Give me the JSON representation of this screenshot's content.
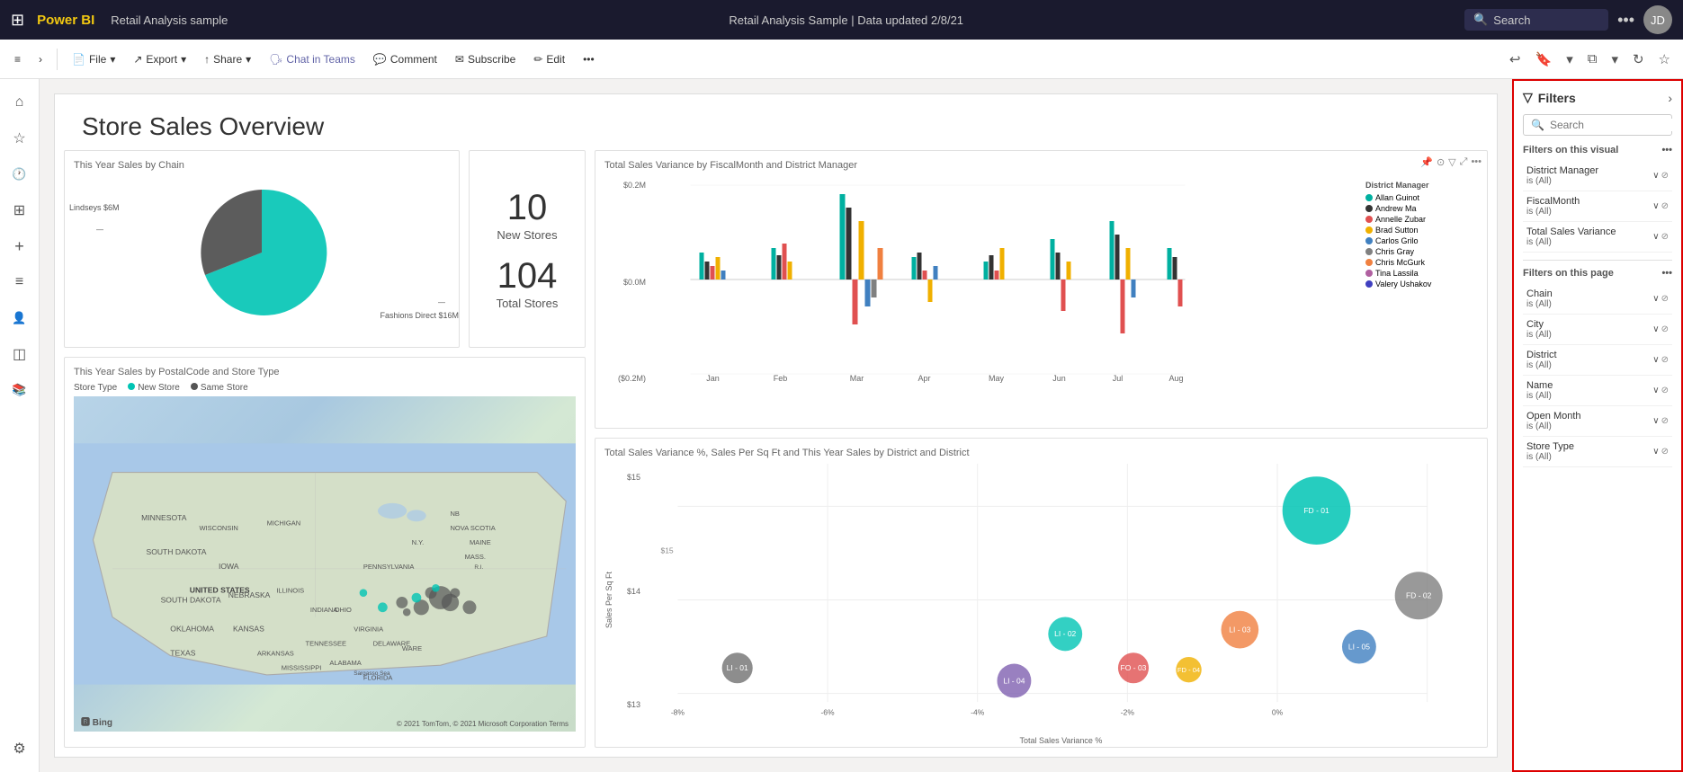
{
  "topnav": {
    "waffle_icon": "⊞",
    "brand": "Power BI",
    "report_name": "Retail Analysis sample",
    "center_title": "Retail Analysis Sample  |  Data updated 2/8/21",
    "dropdown_icon": "▾",
    "search_placeholder": "Search",
    "more_icon": "•••",
    "avatar_initials": "JD"
  },
  "ribbon": {
    "hamburger": "≡",
    "chevron_right": "›",
    "file_label": "File",
    "export_label": "Export",
    "share_label": "Share",
    "chat_label": "Chat in Teams",
    "comment_label": "Comment",
    "subscribe_label": "Subscribe",
    "edit_label": "Edit",
    "more_icon": "•••",
    "undo_icon": "↩",
    "bookmark_icon": "🔖",
    "view_icon": "⧉",
    "refresh_icon": "↻",
    "star_icon": "☆"
  },
  "sidebar": {
    "icons": [
      {
        "name": "home-icon",
        "glyph": "⌂",
        "active": false
      },
      {
        "name": "favorites-icon",
        "glyph": "☆",
        "active": false
      },
      {
        "name": "recent-icon",
        "glyph": "🕐",
        "active": false
      },
      {
        "name": "apps-icon",
        "glyph": "⊞",
        "active": false
      },
      {
        "name": "shared-icon",
        "glyph": "+",
        "active": false
      },
      {
        "name": "dataflow-icon",
        "glyph": "≡",
        "active": false
      },
      {
        "name": "people-icon",
        "glyph": "👤",
        "active": false
      },
      {
        "name": "metrics-icon",
        "glyph": "◫",
        "active": false
      },
      {
        "name": "learn-icon",
        "glyph": "📚",
        "active": false
      },
      {
        "name": "settings-icon",
        "glyph": "⚙",
        "active": false,
        "bottom": true
      }
    ]
  },
  "page": {
    "title": "Store Sales Overview",
    "visuals": {
      "pie_chart": {
        "title": "This Year Sales by Chain",
        "labels": {
          "lindseys": "Lindseys $6M",
          "fashions_direct": "Fashions Direct $16M"
        }
      },
      "kpi": {
        "new_stores_value": "10",
        "new_stores_label": "New Stores",
        "total_stores_value": "104",
        "total_stores_label": "Total Stores"
      },
      "map": {
        "title": "This Year Sales by PostalCode and Store Type",
        "legend_label": "Store Type",
        "new_store_label": "New Store",
        "same_store_label": "Same Store",
        "country_label": "UNITED STATES",
        "bing_label": "🅱 Bing",
        "footer": "© 2021 TomTom, © 2021 Microsoft Corporation  Terms"
      },
      "bar_chart": {
        "title": "Total Sales Variance by FiscalMonth and District Manager",
        "y_labels": [
          "$0.2M",
          "$0.0M",
          "($0.2M)"
        ],
        "x_labels": [
          "Jan",
          "Feb",
          "Mar",
          "Apr",
          "May",
          "Jun",
          "Jul",
          "Aug"
        ],
        "legend": [
          {
            "name": "Allan Guinot",
            "color": "#00b0a0"
          },
          {
            "name": "Andrew Ma",
            "color": "#333333"
          },
          {
            "name": "Annelle Zubar",
            "color": "#e05050"
          },
          {
            "name": "Brad Sutton",
            "color": "#f0b000"
          },
          {
            "name": "Carlos Grilo",
            "color": "#4080c0"
          },
          {
            "name": "Chris Gray",
            "color": "#808080"
          },
          {
            "name": "Chris McGurk",
            "color": "#f08040"
          },
          {
            "name": "Tina Lassila",
            "color": "#b060a0"
          },
          {
            "name": "Valery Ushakov",
            "color": "#4040c0"
          }
        ]
      },
      "scatter_chart": {
        "title": "Total Sales Variance %, Sales Per Sq Ft and This Year Sales by District and District",
        "x_axis_label": "Total Sales Variance %",
        "y_axis_label": "Sales Per Sq Ft",
        "bubbles": [
          {
            "id": "FD-01",
            "x": 85,
            "y": 35,
            "r": 40,
            "color": "#00c4b4",
            "label": "FD - 01"
          },
          {
            "id": "LI-01",
            "x": 8,
            "y": 85,
            "r": 18,
            "color": "#808080",
            "label": "LI - 01"
          },
          {
            "id": "LI-02",
            "x": 52,
            "y": 65,
            "r": 20,
            "color": "#00c4b4",
            "label": "LI - 02"
          },
          {
            "id": "LI-03",
            "x": 75,
            "y": 62,
            "r": 22,
            "color": "#f08040",
            "label": "LI - 03"
          },
          {
            "id": "FO-03",
            "x": 60,
            "y": 85,
            "r": 18,
            "color": "#e05050",
            "label": "FO - 03"
          },
          {
            "id": "FD-04",
            "x": 68,
            "y": 82,
            "r": 15,
            "color": "#f0b000",
            "label": "FD - 04"
          },
          {
            "id": "LI-04",
            "x": 45,
            "y": 90,
            "r": 20,
            "color": "#8060b0",
            "label": "LI - 04"
          },
          {
            "id": "LI-05",
            "x": 90,
            "y": 68,
            "r": 20,
            "color": "#4080c0",
            "label": "LI - 05"
          },
          {
            "id": "FD-02",
            "x": 100,
            "y": 55,
            "r": 28,
            "color": "#808080",
            "label": "FD - 02"
          },
          {
            "id": "x_label1",
            "label": "$13"
          },
          {
            "id": "x_label2",
            "label": "$14"
          },
          {
            "id": "x_label3",
            "label": "$15"
          }
        ],
        "x_ticks": [
          "-8%",
          "-6%",
          "-4%",
          "-2%",
          "0%"
        ],
        "y_ticks": [
          "$13",
          "$14",
          "$15"
        ]
      }
    }
  },
  "filters": {
    "title": "Filters",
    "search_placeholder": "Search",
    "filter_icon": "▽",
    "close_icon": "›",
    "sections": [
      {
        "label": "Filters on this visual",
        "items": [
          {
            "name": "District Manager",
            "value": "is (All)"
          },
          {
            "name": "FiscalMonth",
            "value": "is (All)"
          },
          {
            "name": "Total Sales Variance",
            "value": "is (All)"
          }
        ]
      },
      {
        "label": "Filters on this page",
        "items": [
          {
            "name": "Chain",
            "value": "is (All)"
          },
          {
            "name": "City",
            "value": "is (All)"
          },
          {
            "name": "District",
            "value": "is (All)"
          },
          {
            "name": "Name",
            "value": "is (All)"
          },
          {
            "name": "Open Month",
            "value": "is (All)"
          },
          {
            "name": "Store Type",
            "value": "is (All)"
          }
        ]
      }
    ]
  }
}
